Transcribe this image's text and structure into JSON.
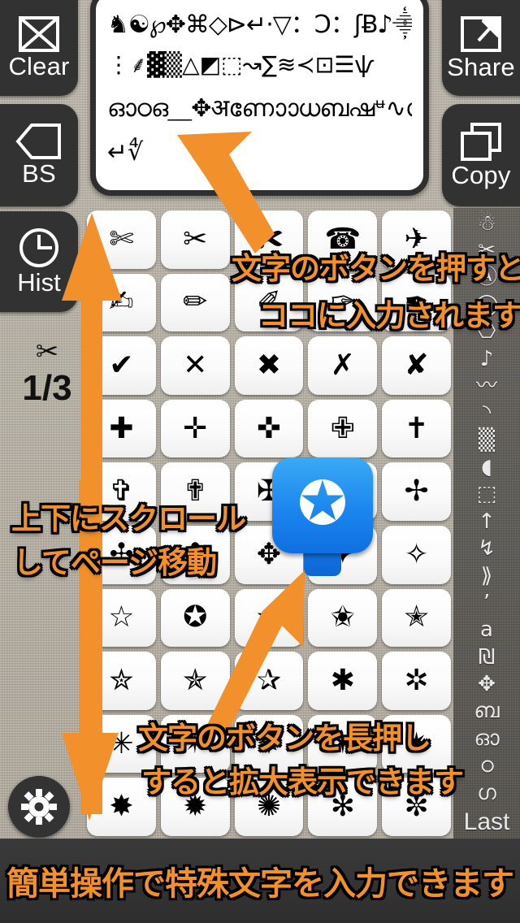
{
  "app": {
    "page_indicator": "1/3",
    "page_indicator_glyph": "✂"
  },
  "toolbar": {
    "clear_label": "Clear",
    "bs_label": "BS",
    "share_label": "Share",
    "copy_label": "Copy",
    "hist_label": "Hist"
  },
  "textfield": {
    "line1": "♞☯℘✥⌘◇⊳↵·▽：Ɔ：ʃɃ♪⸎╲",
    "line2": "⋮⸙▓▒△◩⬚↝∑≋≺⊡☰ѱ",
    "line3": "ഓഠഒ⸏✥अണാോധബഷᶶ∿ഗഉ",
    "line4": "↵∜"
  },
  "grid": {
    "columns": 5,
    "rows": [
      [
        "✄",
        "✂",
        "✀",
        "☎",
        "✈"
      ],
      [
        "✍",
        "✏",
        "✐",
        "✑",
        "✒"
      ],
      [
        "✔",
        "✕",
        "✖",
        "✗",
        "✘"
      ],
      [
        "✚",
        "✛",
        "✜",
        "✙",
        "✝"
      ],
      [
        "✞",
        "✟",
        "✠",
        "✡",
        "✢"
      ],
      [
        "✣",
        "✤",
        "✥",
        "✦",
        "✧"
      ],
      [
        "☆",
        "✪",
        "✫",
        "✬",
        "✭"
      ],
      [
        "✮",
        "✯",
        "✰",
        "✱",
        "✲"
      ],
      [
        "✳",
        "✴",
        "✵",
        "✶",
        "✷"
      ],
      [
        "✸",
        "✹",
        "✺",
        "✻",
        "✼"
      ]
    ]
  },
  "rail": {
    "items": [
      "☃",
      "✂",
      "Ⓐ",
      "◯",
      "⎔",
      "♪",
      "〰",
      "◝",
      "▒",
      "◖",
      "⬚",
      "↑",
      "↯",
      "⟫",
      "ʼ",
      "a",
      "₪",
      "✥",
      "ബ",
      "ഓ",
      "ഠ",
      "ഗ"
    ],
    "last_label": "Last"
  },
  "magnifier": {
    "glyph": "✪"
  },
  "annotations": {
    "tap_line1": "文字のボタンを押すと",
    "tap_line2": "ココに入力されます",
    "scroll_line1": "上下にスクロール",
    "scroll_line2": "してページ移動",
    "longpress_line1": "文字のボタンを長押し",
    "longpress_line2": "すると拡大表示できます"
  },
  "banner": {
    "text": "簡単操作で特殊文字を入力できます"
  },
  "colors": {
    "accent_orange": "#f2902c",
    "popup_blue": "#1b86ee",
    "button_dark": "#323232"
  }
}
